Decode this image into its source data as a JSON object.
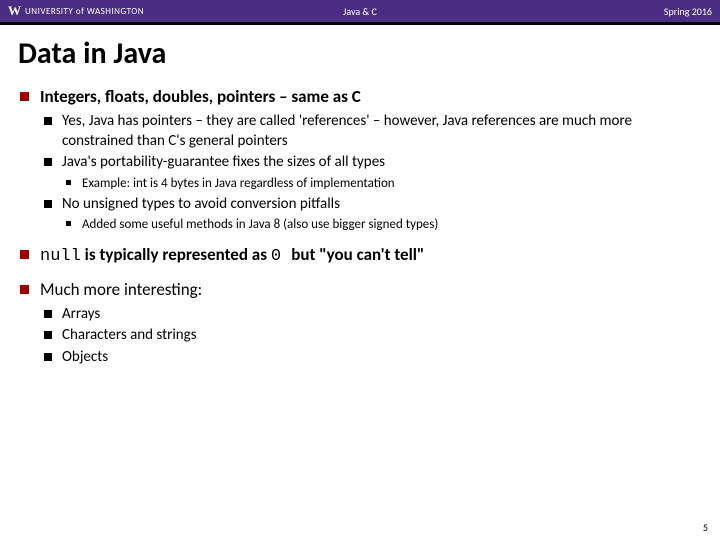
{
  "header": {
    "logo_w": "W",
    "logo_prefix": "UNIVERSITY",
    "logo_of": " of ",
    "logo_suffix": "WASHINGTON",
    "course": "Java & C",
    "term": "Spring 2016"
  },
  "title": "Data in Java",
  "b1": {
    "head": "Integers, floats, doubles, pointers – same as C",
    "s1": "Yes, Java has pointers – they are called 'references' – however, Java references are much more constrained than C's general pointers",
    "s2": "Java's portability-guarantee fixes the sizes of all types",
    "s2a": "Example: int is 4 bytes in Java regardless of implementation",
    "s3": "No unsigned types to avoid conversion pitfalls",
    "s3a": "Added some useful methods in Java 8 (also use bigger signed types)"
  },
  "b2": {
    "code1": "null",
    "mid": " is typically represented as ",
    "code2": " 0 ",
    "tail": "but \"you can't tell\""
  },
  "b3": {
    "head": "Much more interesting:",
    "s1": "Arrays",
    "s2": "Characters and strings",
    "s3": "Objects"
  },
  "page": "5"
}
